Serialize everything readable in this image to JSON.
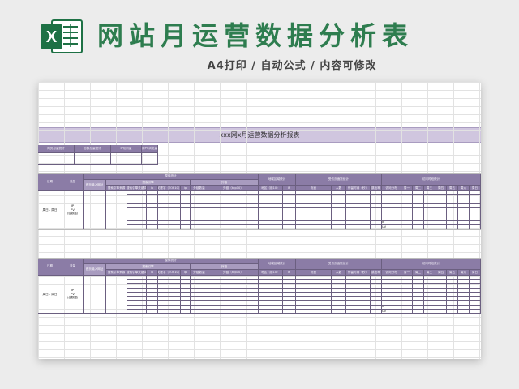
{
  "header": {
    "title": "网站月运营数据分析表",
    "subtitle": "A4打印 / 自动公式 / 内容可修改",
    "icon_letter": "X"
  },
  "sheet": {
    "banner_title": "xxx网x月运营数据分析报表",
    "summary_labels": [
      "网页总量统计",
      "总额总量统计",
      "IP访问量",
      "用PV浏览量"
    ],
    "table": {
      "col_date": "日期",
      "col_metric": "流量",
      "col_entrance": "首页输入网址",
      "group_total": "整体统计",
      "group_search": "搜索引擎",
      "group_external": "外链",
      "col_search_source": "搜索引擎来源",
      "col_search_keyword": "搜索引擎关键词",
      "col_ip1": "ip",
      "col_keyword_top10": "关键字（TOP10）",
      "col_ip2": "ip",
      "col_external_count": "外链数量",
      "col_external_top10": "外链（top10）",
      "group_region": "地域区域统计",
      "col_region": "地区（前10）",
      "col_ip3": "IP",
      "group_page": "受访页面数统计",
      "col_page": "页面",
      "col_visitors": "人数",
      "col_stay": "停留时间（秒）",
      "col_bounce": "跳出率",
      "group_time": "访问时段统计",
      "col_visit_time": "访问分布",
      "weekdays": [
        "周一",
        "周二",
        "周三",
        "周四",
        "周五",
        "周六",
        "周日"
      ],
      "row_date": "周日 - 周日",
      "row_metric_1": "IP",
      "row_metric_2": "PV",
      "row_metric_3": "(合数据)",
      "tail_ip": "IP",
      "tail_pv": "UV"
    }
  },
  "colors": {
    "title_green": "#2e7d4f",
    "header_purple": "#8b7ca6",
    "banner_lilac": "#d0c6df",
    "excel_green": "#1e7145"
  }
}
